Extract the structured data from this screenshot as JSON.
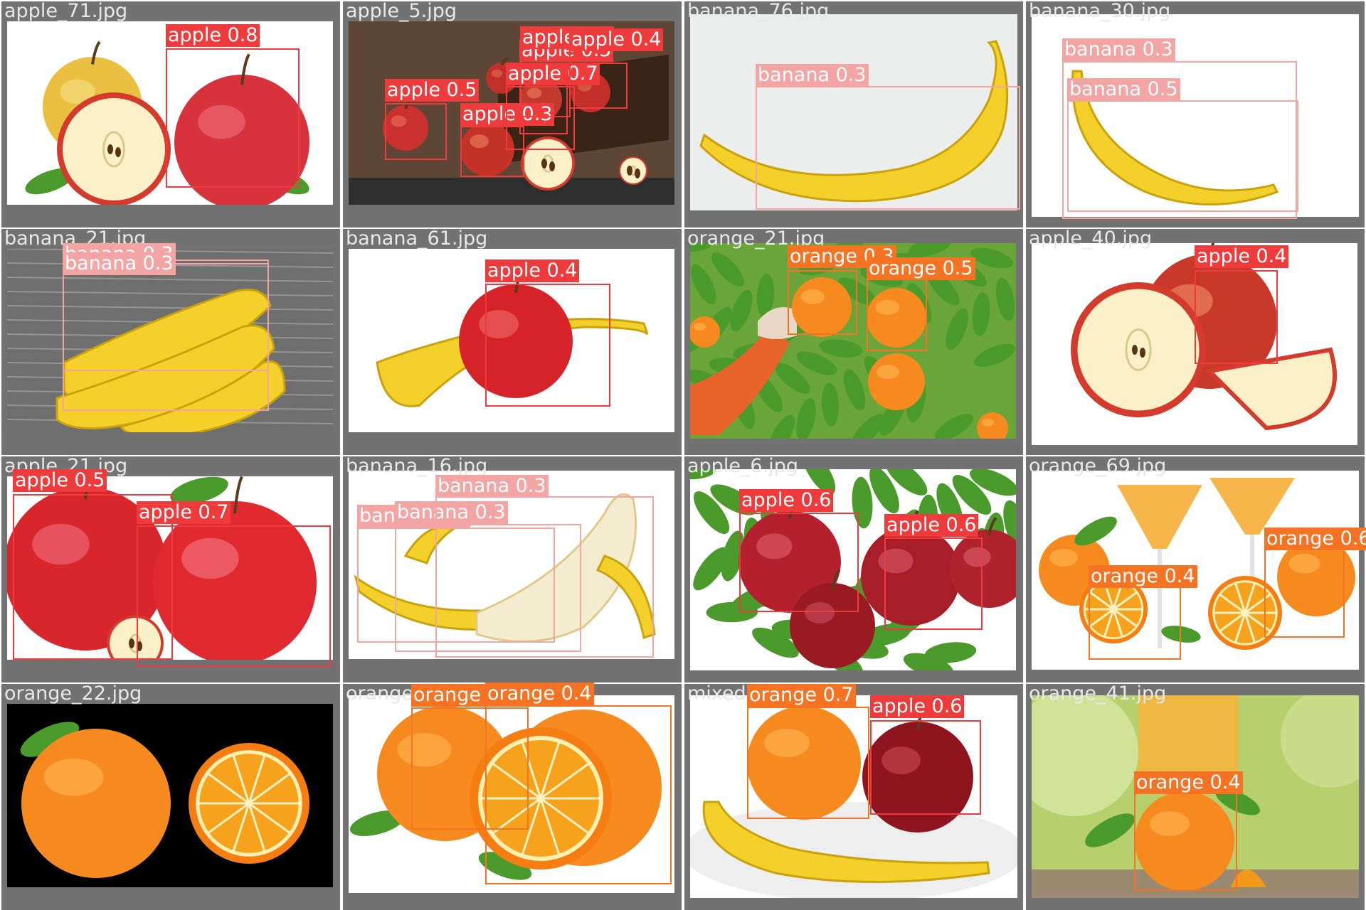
{
  "colors": {
    "apple": "#ef3b3b",
    "banana": "#f3a5a3",
    "orange": "#f57323",
    "tile_bg": "#727272"
  },
  "tiles": [
    {
      "file": "apple_71.jpg",
      "scene": "apples-white",
      "detections": [
        {
          "label": "apple 0.8",
          "cls": "apple"
        }
      ]
    },
    {
      "file": "apple_5.jpg",
      "scene": "apples-crate",
      "detections": [
        {
          "label": "apple 0.5",
          "cls": "apple"
        },
        {
          "label": "apple 0.3",
          "cls": "apple"
        },
        {
          "label": "apple 0.5",
          "cls": "apple"
        },
        {
          "label": "apple 0.7",
          "cls": "apple"
        },
        {
          "label": "apple 0.5",
          "cls": "apple"
        },
        {
          "label": "apple 0.4",
          "cls": "apple"
        }
      ]
    },
    {
      "file": "banana_76.jpg",
      "scene": "banana-grey",
      "detections": [
        {
          "label": "banana 0.3",
          "cls": "banana"
        }
      ]
    },
    {
      "file": "banana_30.jpg",
      "scene": "banana-curved",
      "detections": [
        {
          "label": "banana 0.3",
          "cls": "banana"
        },
        {
          "label": "banana 0.5",
          "cls": "banana"
        }
      ]
    },
    {
      "file": "banana_21.jpg",
      "scene": "bananas-water",
      "detections": [
        {
          "label": "banana 0.3",
          "cls": "banana"
        },
        {
          "label": "banana 0.3",
          "cls": "banana"
        }
      ]
    },
    {
      "file": "banana_61.jpg",
      "scene": "banana-apple",
      "detections": [
        {
          "label": "apple 0.4",
          "cls": "apple"
        }
      ]
    },
    {
      "file": "orange_21.jpg",
      "scene": "orange-tree",
      "detections": [
        {
          "label": "orange 0.3",
          "cls": "orange"
        },
        {
          "label": "orange 0.5",
          "cls": "orange"
        }
      ]
    },
    {
      "file": "apple_40.jpg",
      "scene": "apple-cut",
      "detections": [
        {
          "label": "apple 0.4",
          "cls": "apple"
        }
      ]
    },
    {
      "file": "apple_21.jpg",
      "scene": "apples-red",
      "detections": [
        {
          "label": "apple 0.5",
          "cls": "apple"
        },
        {
          "label": "apple 0.7",
          "cls": "apple"
        }
      ]
    },
    {
      "file": "banana_16.jpg",
      "scene": "banana-peeled",
      "detections": [
        {
          "label": "banana 0.4",
          "cls": "banana"
        },
        {
          "label": "banana 0.3",
          "cls": "banana"
        },
        {
          "label": "banana 0.3",
          "cls": "banana"
        }
      ]
    },
    {
      "file": "apple_6.jpg",
      "scene": "apple-tree",
      "detections": [
        {
          "label": "apple 0.6",
          "cls": "apple"
        },
        {
          "label": "apple 0.6",
          "cls": "apple"
        }
      ]
    },
    {
      "file": "orange_69.jpg",
      "scene": "orange-juice",
      "detections": [
        {
          "label": "orange 0.6",
          "cls": "orange"
        },
        {
          "label": "orange 0.4",
          "cls": "orange"
        }
      ]
    },
    {
      "file": "orange_22.jpg",
      "scene": "orange-black",
      "detections": []
    },
    {
      "file": "orange_5.jpg",
      "scene": "oranges-white",
      "detections": [
        {
          "label": "orange 0.5",
          "cls": "orange"
        },
        {
          "label": "orange 0.4",
          "cls": "orange"
        }
      ]
    },
    {
      "file": "mixed_4.jpg",
      "scene": "mixed",
      "detections": [
        {
          "label": "orange 0.7",
          "cls": "orange"
        },
        {
          "label": "apple 0.6",
          "cls": "apple"
        }
      ]
    },
    {
      "file": "orange_41.jpg",
      "scene": "orange-glass",
      "detections": [
        {
          "label": "orange 0.4",
          "cls": "orange"
        }
      ]
    }
  ]
}
